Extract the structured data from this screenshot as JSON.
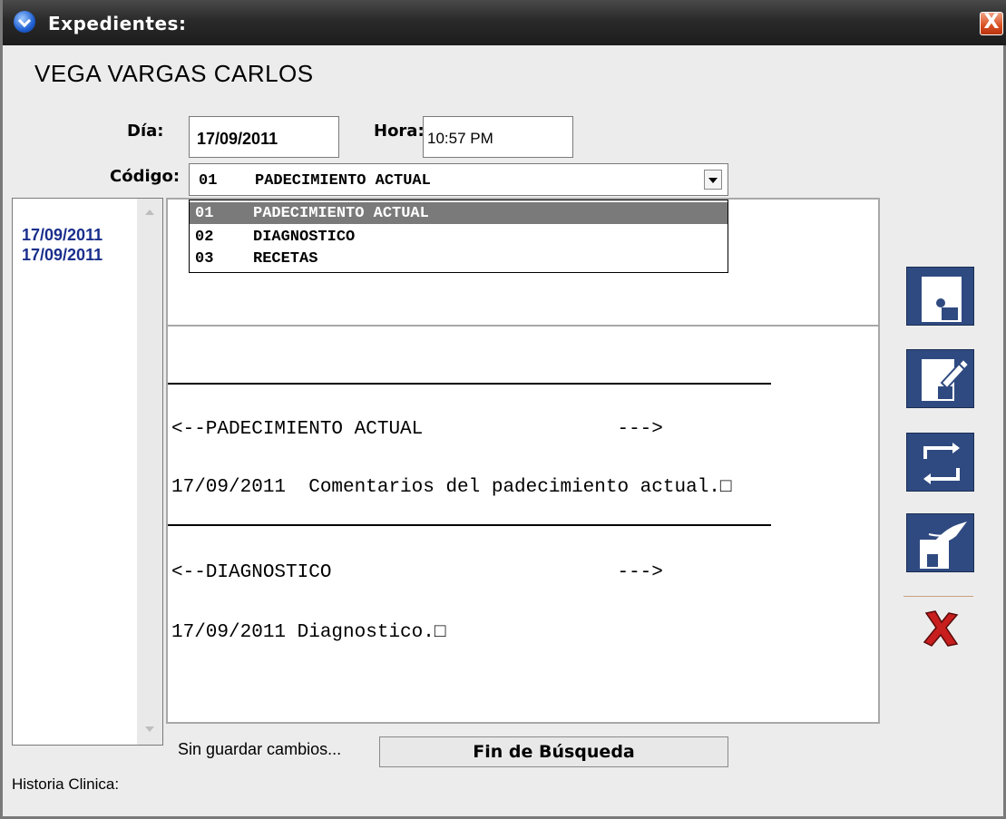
{
  "window": {
    "title": "Expedientes:",
    "close_label": "X"
  },
  "patient": {
    "name": "VEGA VARGAS CARLOS"
  },
  "form": {
    "day_label": "Día:",
    "day_value": "17/09/2011",
    "hour_label": "Hora:",
    "hour_value": "10:57 PM",
    "code_label": "Código:",
    "code_selected_code": "01",
    "code_selected_desc": "PADECIMIENTO ACTUAL"
  },
  "dropdown": {
    "options": [
      {
        "code": "01",
        "desc": "PADECIMIENTO ACTUAL"
      },
      {
        "code": "02",
        "desc": "DIAGNOSTICO"
      },
      {
        "code": "03",
        "desc": "RECETAS"
      }
    ]
  },
  "history_list": {
    "items": [
      "17/09/2011",
      "17/09/2011"
    ]
  },
  "record": {
    "section1_header": "<--PADECIMIENTO ACTUAL                 --->",
    "section1_entry": "17/09/2011  Comentarios del padecimiento actual.□",
    "section2_header": "<--DIAGNOSTICO                         --->",
    "section2_entry": "17/09/2011 Diagnostico.□"
  },
  "toolbar": {
    "icons": [
      "save-disk-icon",
      "edit-disk-icon",
      "refresh-icon",
      "sign-disk-icon",
      "cancel-x-icon"
    ],
    "colors": {
      "button_bg": "#2f4a80",
      "cancel": "#c81e1e"
    }
  },
  "status": {
    "text": "Sin guardar cambios...",
    "search_status": "Fin de Búsqueda",
    "history_label": "Historia Clinica:"
  }
}
